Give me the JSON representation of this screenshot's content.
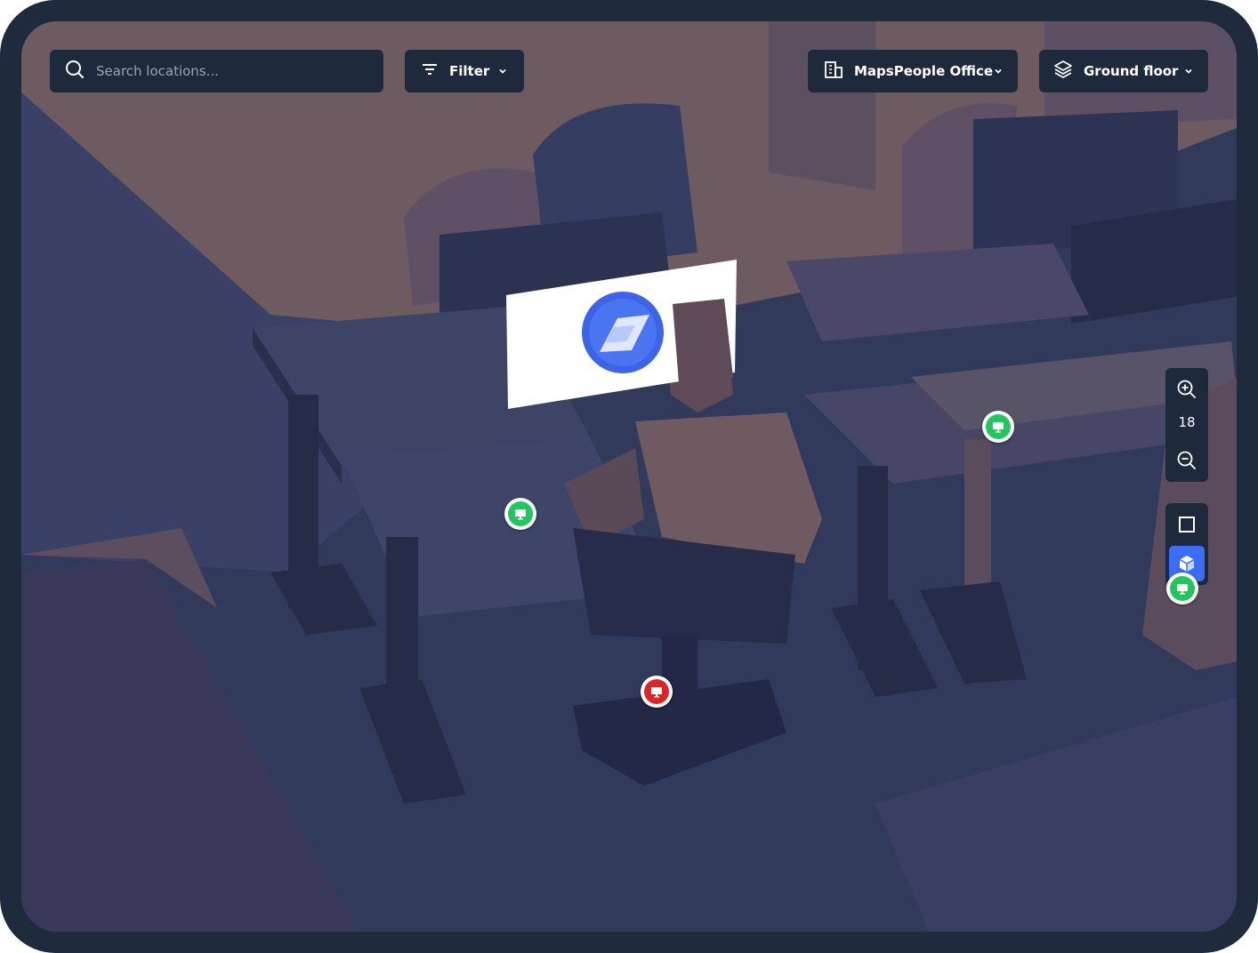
{
  "search": {
    "placeholder": "Search locations..."
  },
  "filter": {
    "label": "Filter"
  },
  "venue": {
    "label": "MapsPeople Office"
  },
  "floor": {
    "label": "Ground floor"
  },
  "zoom": {
    "level": "18"
  },
  "view_mode": {
    "active": "3d",
    "options": [
      "2d",
      "3d"
    ]
  },
  "markers": [
    {
      "type": "desk",
      "status": "available"
    },
    {
      "type": "desk",
      "status": "available"
    },
    {
      "type": "desk",
      "status": "available"
    },
    {
      "type": "desk",
      "status": "occupied"
    }
  ],
  "colors": {
    "available": "#22c55e",
    "occupied": "#dc2626",
    "accent": "#3b6ef5",
    "control_bg": "#1e293b"
  }
}
